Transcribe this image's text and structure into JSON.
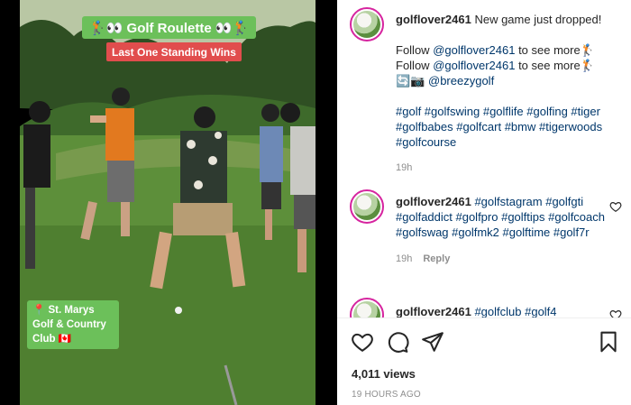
{
  "video": {
    "title_sticker": "🏌️👀 Golf Roulette 👀🏌️",
    "subtitle_sticker": "Last One Standing Wins",
    "location_sticker": "📍 St. Marys Golf & Country Club 🇨🇦"
  },
  "caption": {
    "username": "golflover2461",
    "line1": "New game just dropped!",
    "line2_prefix": "Follow ",
    "line2_handle": "@golflover2461",
    "line2_suffix": " to see more🏌️",
    "line3_prefix": "Follow ",
    "line3_handle": "@golflover2461",
    "line3_suffix": " to see more🏌️",
    "line4_prefix": "🔄📷 ",
    "line4_handle": "@breezygolf",
    "hashtags": "#golf #golfswing #golflife #golfing #tiger #golfbabes #golfcart #bmw #tigerwoods #golfcourse",
    "time": "19h"
  },
  "comment1": {
    "username": "golflover2461",
    "hashtags_first": "#golfstagram #golfgti",
    "hashtags_rest": "#golfaddict #golfpro #golftips #golfcoach #golfswag #golfmk2 #golftime #golf7r",
    "time": "19h",
    "reply_label": "Reply"
  },
  "comment2": {
    "username": "golflover2461",
    "hashtags_first": "#golfclub #golf4"
  },
  "footer": {
    "views": "4,011 views",
    "posted_ago": "19 HOURS AGO"
  }
}
